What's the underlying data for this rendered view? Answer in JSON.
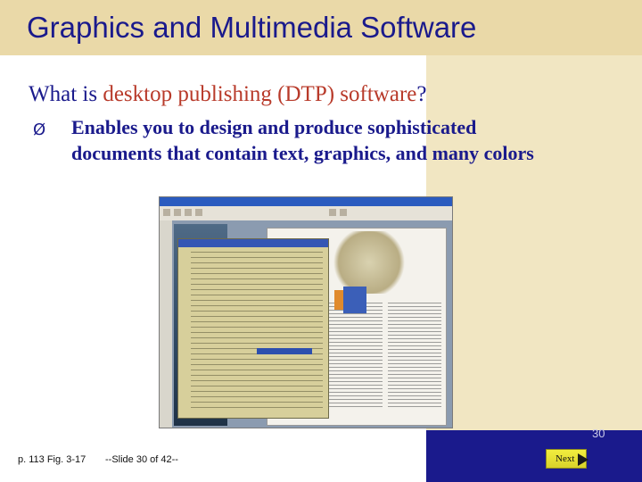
{
  "slide": {
    "title": "Graphics and Multimedia Software",
    "question": {
      "prefix": "What is ",
      "highlight": "desktop publishing (DTP) software",
      "suffix": "?"
    },
    "bullet_symbol": "Ø",
    "bullet_text": "Enables you to design and produce sophisticated documents that contain text, graphics, and many colors",
    "screenshot_icon": "dtp-application-screenshot"
  },
  "footer": {
    "reference": "p. 113 Fig. 3-17",
    "slide_label": "--Slide 30 of 42--",
    "next_label": "Next",
    "page_number": "30"
  },
  "colors": {
    "title": "#1a1a8c",
    "highlight": "#b83a2a",
    "band_top": "#ead9a8",
    "band_right": "#f1e6c2",
    "band_bottom_right": "#1a1a8c",
    "next_button": "#e6e032"
  }
}
